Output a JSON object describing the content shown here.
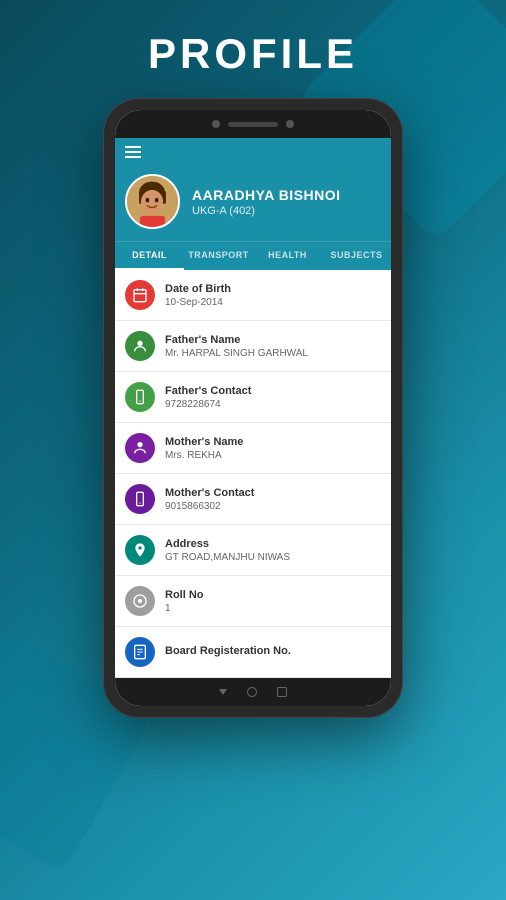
{
  "page": {
    "title": "PROFILE"
  },
  "profile": {
    "name": "AARADHYA BISHNOI",
    "class": "UKG-A (402)"
  },
  "tabs": [
    {
      "id": "detail",
      "label": "DETAIL",
      "active": true
    },
    {
      "id": "transport",
      "label": "TRANSPORT",
      "active": false
    },
    {
      "id": "health",
      "label": "HEALTH",
      "active": false
    },
    {
      "id": "subjects",
      "label": "SUBJECTS",
      "active": false
    }
  ],
  "detail_items": [
    {
      "id": "dob",
      "label": "Date of Birth",
      "value": "10-Sep-2014",
      "icon_color": "red",
      "icon_symbol": "📅"
    },
    {
      "id": "father_name",
      "label": "Father's Name",
      "value": "Mr. HARPAL SINGH GARHWAL",
      "icon_color": "green-dark",
      "icon_symbol": "👤"
    },
    {
      "id": "father_contact",
      "label": "Father's Contact",
      "value": "9728228674",
      "icon_color": "green",
      "icon_symbol": "📱"
    },
    {
      "id": "mother_name",
      "label": "Mother's Name",
      "value": "Mrs. REKHA",
      "icon_color": "purple",
      "icon_symbol": "👤"
    },
    {
      "id": "mother_contact",
      "label": "Mother's Contact",
      "value": "9015866302",
      "icon_color": "purple-dark",
      "icon_symbol": "📱"
    },
    {
      "id": "address",
      "label": "Address",
      "value": "GT ROAD,MANJHU NIWAS",
      "icon_color": "teal",
      "icon_symbol": "🏠"
    },
    {
      "id": "roll_no",
      "label": "Roll No",
      "value": "1",
      "icon_color": "gray",
      "icon_symbol": "⊙"
    },
    {
      "id": "board_reg",
      "label": "Board Registeration No.",
      "value": "",
      "icon_color": "blue",
      "icon_symbol": "📋"
    }
  ]
}
